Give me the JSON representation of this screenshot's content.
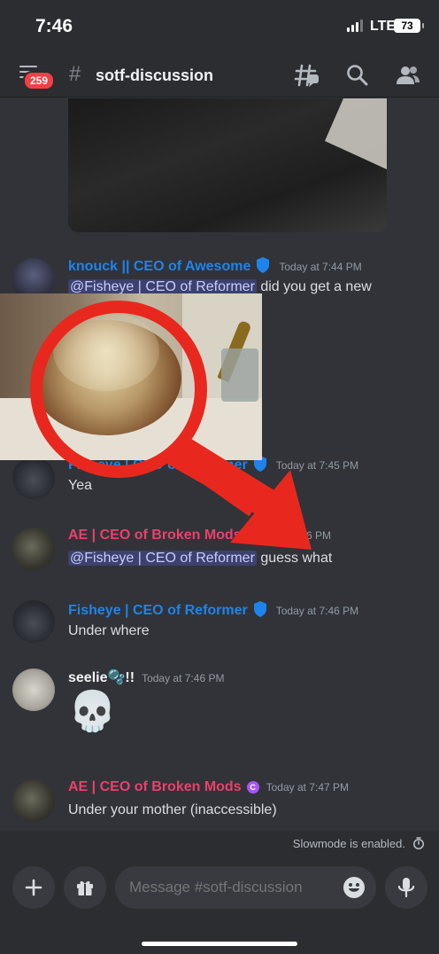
{
  "status_bar": {
    "time": "7:46",
    "network": "LTE",
    "battery": "73"
  },
  "header": {
    "notification_badge": "259",
    "hash": "#",
    "channel_name": "sotf-discussion"
  },
  "messages": [
    {
      "author": "knouck || CEO of Awesome",
      "author_color": "#1e84ea",
      "verified": true,
      "timestamp": "Today at 7:44 PM",
      "mention": "@Fisheye | CEO of Reformer",
      "text": " did you get a new"
    },
    {
      "author": "Fisheye | CEO of Reformer",
      "author_color": "#1e84ea",
      "verified": true,
      "timestamp": "Today at 7:45 PM",
      "text": "Yea"
    },
    {
      "author": "AE | CEO of Broken Mods",
      "author_color": "#e9416c",
      "timestamp": "Today at 7:46 PM",
      "mention": "@Fisheye | CEO of Reformer",
      "text": " guess what"
    },
    {
      "author": "Fisheye | CEO of Reformer",
      "author_color": "#1e84ea",
      "verified": true,
      "timestamp": "Today at 7:46 PM",
      "text": "Under where"
    },
    {
      "author": "seelie🫧!!",
      "author_color": "#f2f3f5",
      "timestamp": "Today at 7:46 PM",
      "text": "💀"
    },
    {
      "author": "AE | CEO of Broken Mods",
      "author_color": "#e9416c",
      "boost": true,
      "boost_label": "C",
      "timestamp": "Today at 7:47 PM",
      "text": "Under your mother (inaccessible)"
    }
  ],
  "slowmode": {
    "text": "Slowmode is enabled."
  },
  "composer": {
    "placeholder": "Message #sotf-discussion"
  },
  "colors": {
    "background": "#313338",
    "header": "#2b2d31",
    "meme_red": "#e8281e"
  },
  "icons": [
    "hamburger-icon",
    "threads-icon",
    "search-icon",
    "members-icon",
    "verified-icon",
    "plus-icon",
    "gift-icon",
    "emoji-icon",
    "mic-icon",
    "timer-icon"
  ]
}
